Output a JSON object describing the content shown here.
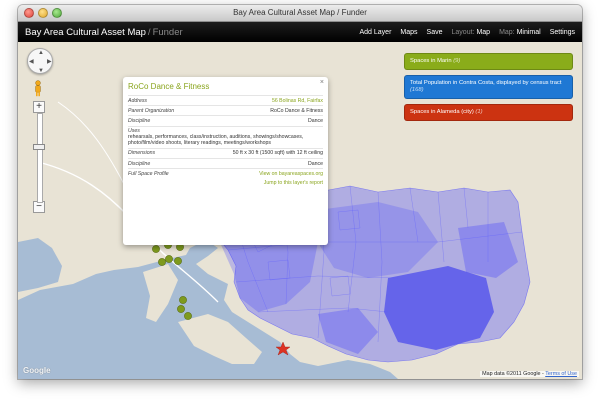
{
  "window": {
    "title": "Bay Area Cultural Asset Map / Funder"
  },
  "app": {
    "title": "Bay Area Cultural Asset Map",
    "separator": " / ",
    "subtitle": "Funder",
    "nav": {
      "add_layer": "Add Layer",
      "maps": "Maps",
      "save": "Save",
      "layout_label": "Layout:",
      "layout_value": "Map",
      "map_label": "Map:",
      "map_value": "Minimal",
      "settings": "Settings"
    }
  },
  "popup": {
    "title": "RoCo Dance & Fitness",
    "close": "×",
    "rows": [
      {
        "label": "Address",
        "value": "56 Bolinas Rd, Fairfax",
        "link": true
      },
      {
        "label": "Parent Organization",
        "value": "RoCo Dance & Fitness",
        "link": false
      },
      {
        "label": "Discipline",
        "value": "Dance",
        "link": false
      }
    ],
    "uses_label": "Uses",
    "uses_value": "rehearsals, performances, class/instruction, auditions, showings/showcases, photo/film/video shoots, literary readings, meetings/workshops",
    "rows2": [
      {
        "label": "Dimensions",
        "value": "50 ft x 30 ft (1500 sqft) with 12 ft ceiling",
        "link": false
      },
      {
        "label": "Discipline",
        "value": "Dance",
        "link": false
      },
      {
        "label": "Full Space Profile",
        "value": "View on bayareaspaces.org",
        "link": true
      }
    ],
    "jump_link": "Jump to this layer's report"
  },
  "layers": [
    {
      "label": "Spaces in Marin",
      "count": "(9)",
      "color": "#8aac1a"
    },
    {
      "label": "Total Population in Contra Costa, displayed by census tract",
      "count": "(168)",
      "color": "#1f78d4"
    },
    {
      "label": "Spaces in Alameda (city)",
      "count": "(1)",
      "color": "#cc3311"
    }
  ],
  "map": {
    "google_logo": "Google",
    "attribution": "Map data ©2011 Google -",
    "terms": "Terms of Use",
    "zoom_in": "+",
    "zoom_out": "−",
    "marker_color": "#7e9a1e",
    "highlight_marker_color": "#dd3322",
    "choropleth_color": "#3c3cff"
  }
}
